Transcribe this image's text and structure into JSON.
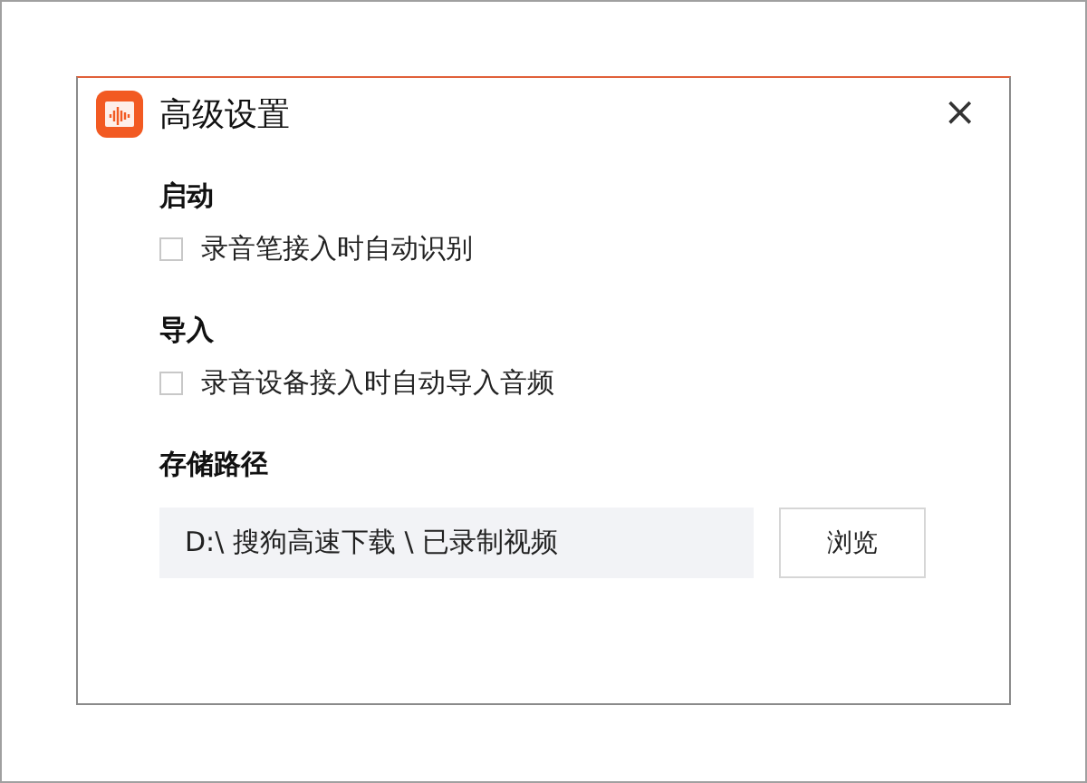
{
  "window": {
    "title": "高级设置",
    "close": "×"
  },
  "sections": [
    {
      "kind": "checkbox",
      "heading": "启动",
      "label": "录音笔接入时自动识别",
      "checked": false
    },
    {
      "kind": "checkbox",
      "heading": "导入",
      "label": "录音设备接入时自动导入音频",
      "checked": false
    },
    {
      "kind": "path",
      "heading": "存储路径",
      "value": "D:\\ 搜狗高速下载 \\ 已录制视频",
      "button": "浏览"
    }
  ]
}
